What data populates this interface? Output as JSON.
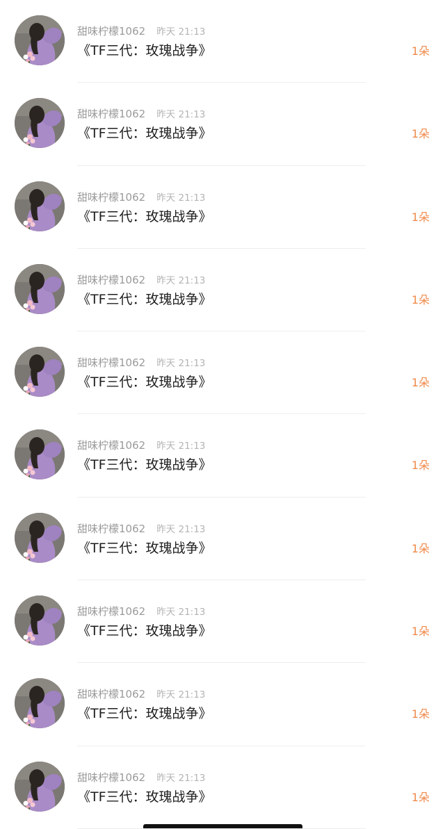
{
  "items": [
    {
      "username": "甜味柠檬1062",
      "time": "昨天 21:13",
      "message": "《TF三代：玫瑰战争》",
      "gift": "1朵"
    },
    {
      "username": "甜味柠檬1062",
      "time": "昨天 21:13",
      "message": "《TF三代：玫瑰战争》",
      "gift": "1朵"
    },
    {
      "username": "甜味柠檬1062",
      "time": "昨天 21:13",
      "message": "《TF三代：玫瑰战争》",
      "gift": "1朵"
    },
    {
      "username": "甜味柠檬1062",
      "time": "昨天 21:13",
      "message": "《TF三代：玫瑰战争》",
      "gift": "1朵"
    },
    {
      "username": "甜味柠檬1062",
      "time": "昨天 21:13",
      "message": "《TF三代：玫瑰战争》",
      "gift": "1朵"
    },
    {
      "username": "甜味柠檬1062",
      "time": "昨天 21:13",
      "message": "《TF三代：玫瑰战争》",
      "gift": "1朵"
    },
    {
      "username": "甜味柠檬1062",
      "time": "昨天 21:13",
      "message": "《TF三代：玫瑰战争》",
      "gift": "1朵"
    },
    {
      "username": "甜味柠檬1062",
      "time": "昨天 21:13",
      "message": "《TF三代：玫瑰战争》",
      "gift": "1朵"
    },
    {
      "username": "甜味柠檬1062",
      "time": "昨天 21:13",
      "message": "《TF三代：玫瑰战争》",
      "gift": "1朵"
    },
    {
      "username": "甜味柠檬1062",
      "time": "昨天 21:13",
      "message": "《TF三代：玫瑰战争》",
      "gift": "1朵"
    }
  ],
  "colors": {
    "gift_accent": "#f08a4b",
    "username": "#9a9a9a",
    "timestamp": "#b4b4b4",
    "message": "#1e1e1e",
    "divider": "#eeeeee",
    "avatar_sweater": "#a98bc7"
  },
  "icons": {
    "avatar": "user-avatar-photo"
  }
}
